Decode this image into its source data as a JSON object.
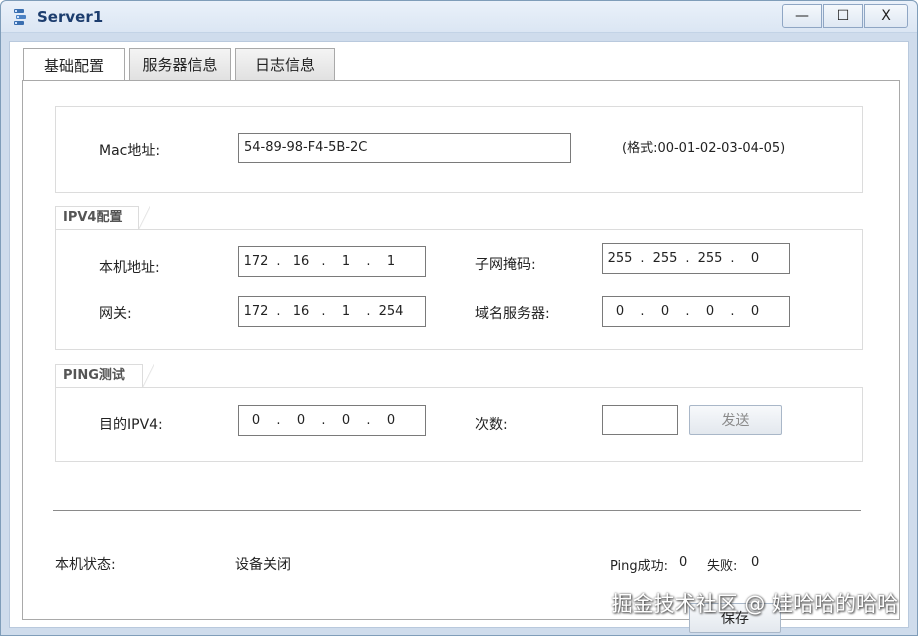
{
  "window": {
    "title": "Server1",
    "min_glyph": "—",
    "max_glyph": "☐",
    "close_glyph": "X"
  },
  "tabs": [
    {
      "label": "基础配置"
    },
    {
      "label": "服务器信息"
    },
    {
      "label": "日志信息"
    }
  ],
  "mac": {
    "label": "Mac地址:",
    "value": "54-89-98-F4-5B-2C",
    "hint": "(格式:00-01-02-03-04-05)"
  },
  "ipv4": {
    "title": "IPV4配置",
    "local_label": "本机地址:",
    "local": [
      "172",
      "16",
      "1",
      "1"
    ],
    "mask_label": "子网掩码:",
    "mask": [
      "255",
      "255",
      "255",
      "0"
    ],
    "gateway_label": "网关:",
    "gateway": [
      "172",
      "16",
      "1",
      "254"
    ],
    "dns_label": "域名服务器:",
    "dns": [
      "0",
      "0",
      "0",
      "0"
    ]
  },
  "ping": {
    "title": "PING测试",
    "dest_label": "目的IPV4:",
    "dest": [
      "0",
      "0",
      "0",
      "0"
    ],
    "count_label": "次数:",
    "count_value": "",
    "send_label": "发送"
  },
  "status": {
    "label": "本机状态:",
    "value": "设备关闭",
    "ping_success_label": "Ping成功:",
    "ping_success": "0",
    "fail_label": "失败:",
    "fail": "0"
  },
  "save_label": "保存",
  "watermark": "掘金技术社区 @ 娃哈哈的哈哈"
}
